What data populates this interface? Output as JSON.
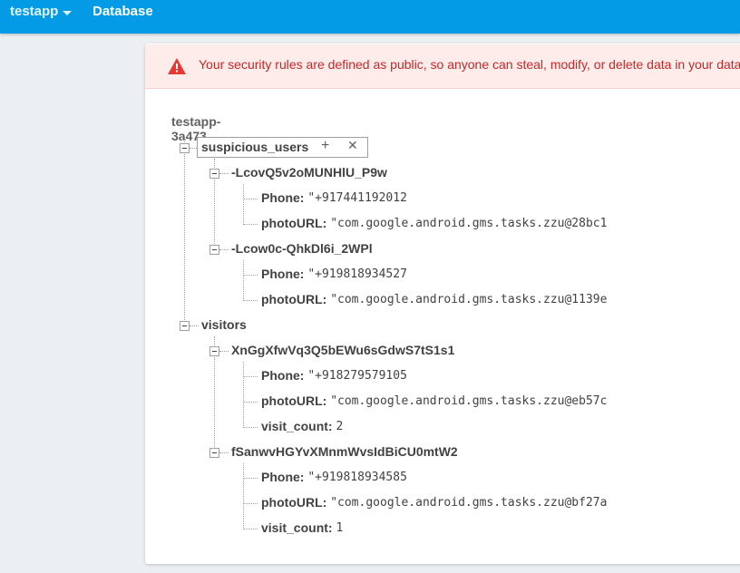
{
  "topbar": {
    "project": "testapp",
    "section": "Database"
  },
  "banner": {
    "text": "Your security rules are defined as public, so anyone can steal, modify, or delete data in your database",
    "color": "#c62828"
  },
  "tree": {
    "root": "testapp-3a473",
    "suspicious_users": {
      "key": "suspicious_users",
      "add_icon": "+",
      "delete_icon": "✕",
      "children": [
        {
          "key": "-LcovQ5v2oMUNHlU_P9w",
          "phone_key": "Phone:",
          "phone": "\"+917441192012",
          "photo_key": "photoURL:",
          "photo": "\"com.google.android.gms.tasks.zzu@28bc1"
        },
        {
          "key": "-Lcow0c-QhkDl6i_2WPl",
          "phone_key": "Phone:",
          "phone": "\"+919818934527",
          "photo_key": "photoURL:",
          "photo": "\"com.google.android.gms.tasks.zzu@1139e"
        }
      ]
    },
    "visitors": {
      "key": "visitors",
      "children": [
        {
          "key": "XnGgXfwVq3Q5bEWu6sGdwS7tS1s1",
          "phone_key": "Phone:",
          "phone": "\"+918279579105",
          "photo_key": "photoURL:",
          "photo": "\"com.google.android.gms.tasks.zzu@eb57c",
          "count_key": "visit_count:",
          "count": "2"
        },
        {
          "key": "fSanwvHGYvXMnmWvsIdBiCU0mtW2",
          "phone_key": "Phone:",
          "phone": "\"+919818934585",
          "photo_key": "photoURL:",
          "photo": "\"com.google.android.gms.tasks.zzu@bf27a",
          "count_key": "visit_count:",
          "count": "1"
        }
      ]
    }
  }
}
